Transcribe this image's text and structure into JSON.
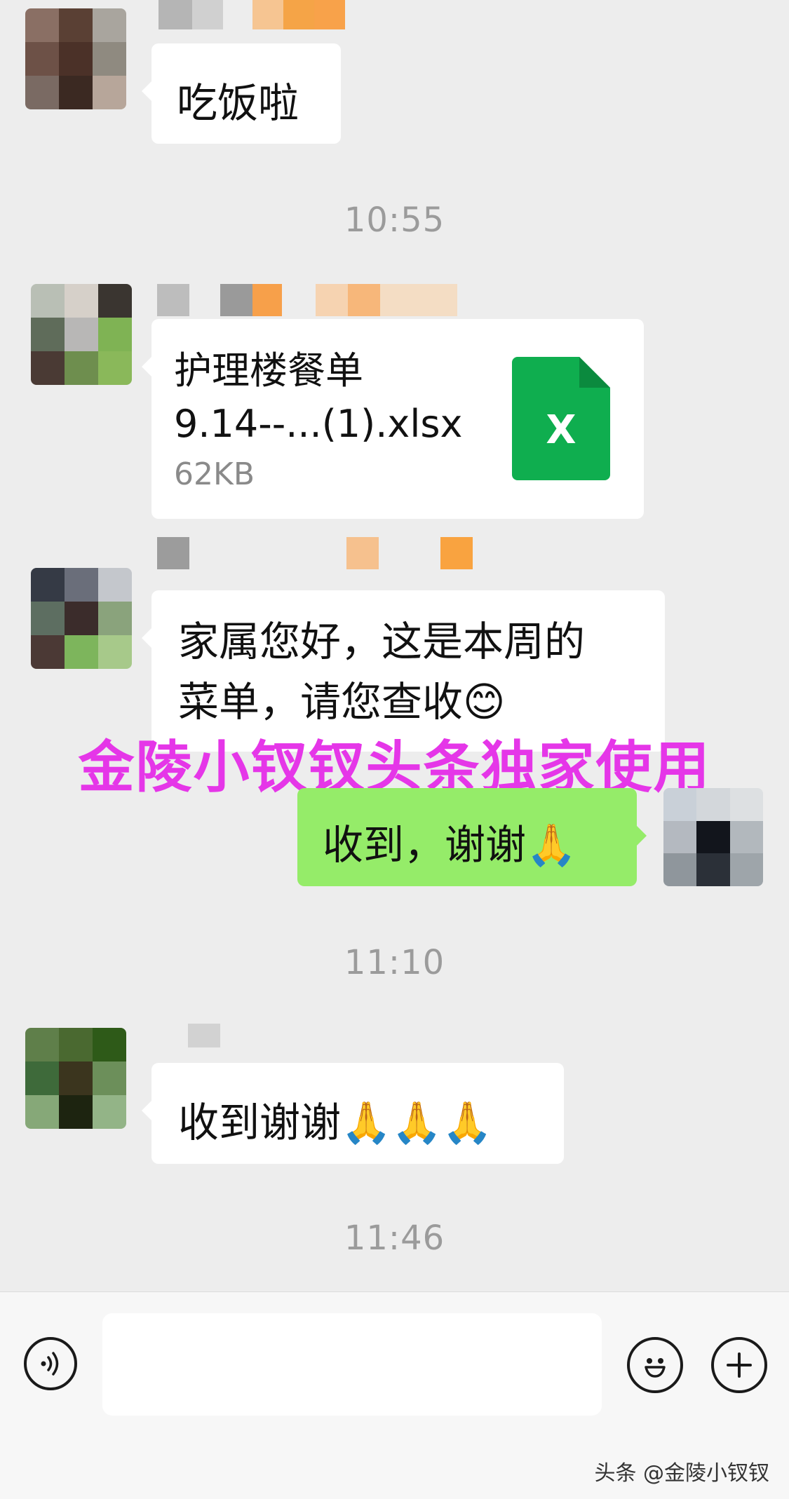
{
  "messages": {
    "msg1": {
      "text": "吃饭啦"
    },
    "time1": "10:55",
    "file": {
      "name_line1": "护理楼餐单",
      "name_line2": "9.14--...(1).xlsx",
      "size": "62KB",
      "icon_letter": "X",
      "icon_color": "#0f9d58"
    },
    "msg3": {
      "line1": "家属您好，这是本周的",
      "line2": "菜单，请您查收😊"
    },
    "reply": {
      "text": "收到，谢谢🙏"
    },
    "time2": "11:10",
    "msg5": {
      "text": "收到谢谢🙏🙏🙏"
    },
    "time3": "11:46"
  },
  "watermark": "金陵小钗钗头条独家使用",
  "input_bar": {
    "voice_icon": "voice-icon",
    "emoji_icon": "emoji-icon",
    "plus_icon": "plus-icon",
    "input_value": ""
  },
  "credit": "头条 @金陵小钗钗",
  "colors": {
    "background": "#ededed",
    "incoming_bubble": "#ffffff",
    "outgoing_bubble": "#95ec69",
    "watermark": "#e536e8",
    "excel_green": "#0f9d58"
  }
}
